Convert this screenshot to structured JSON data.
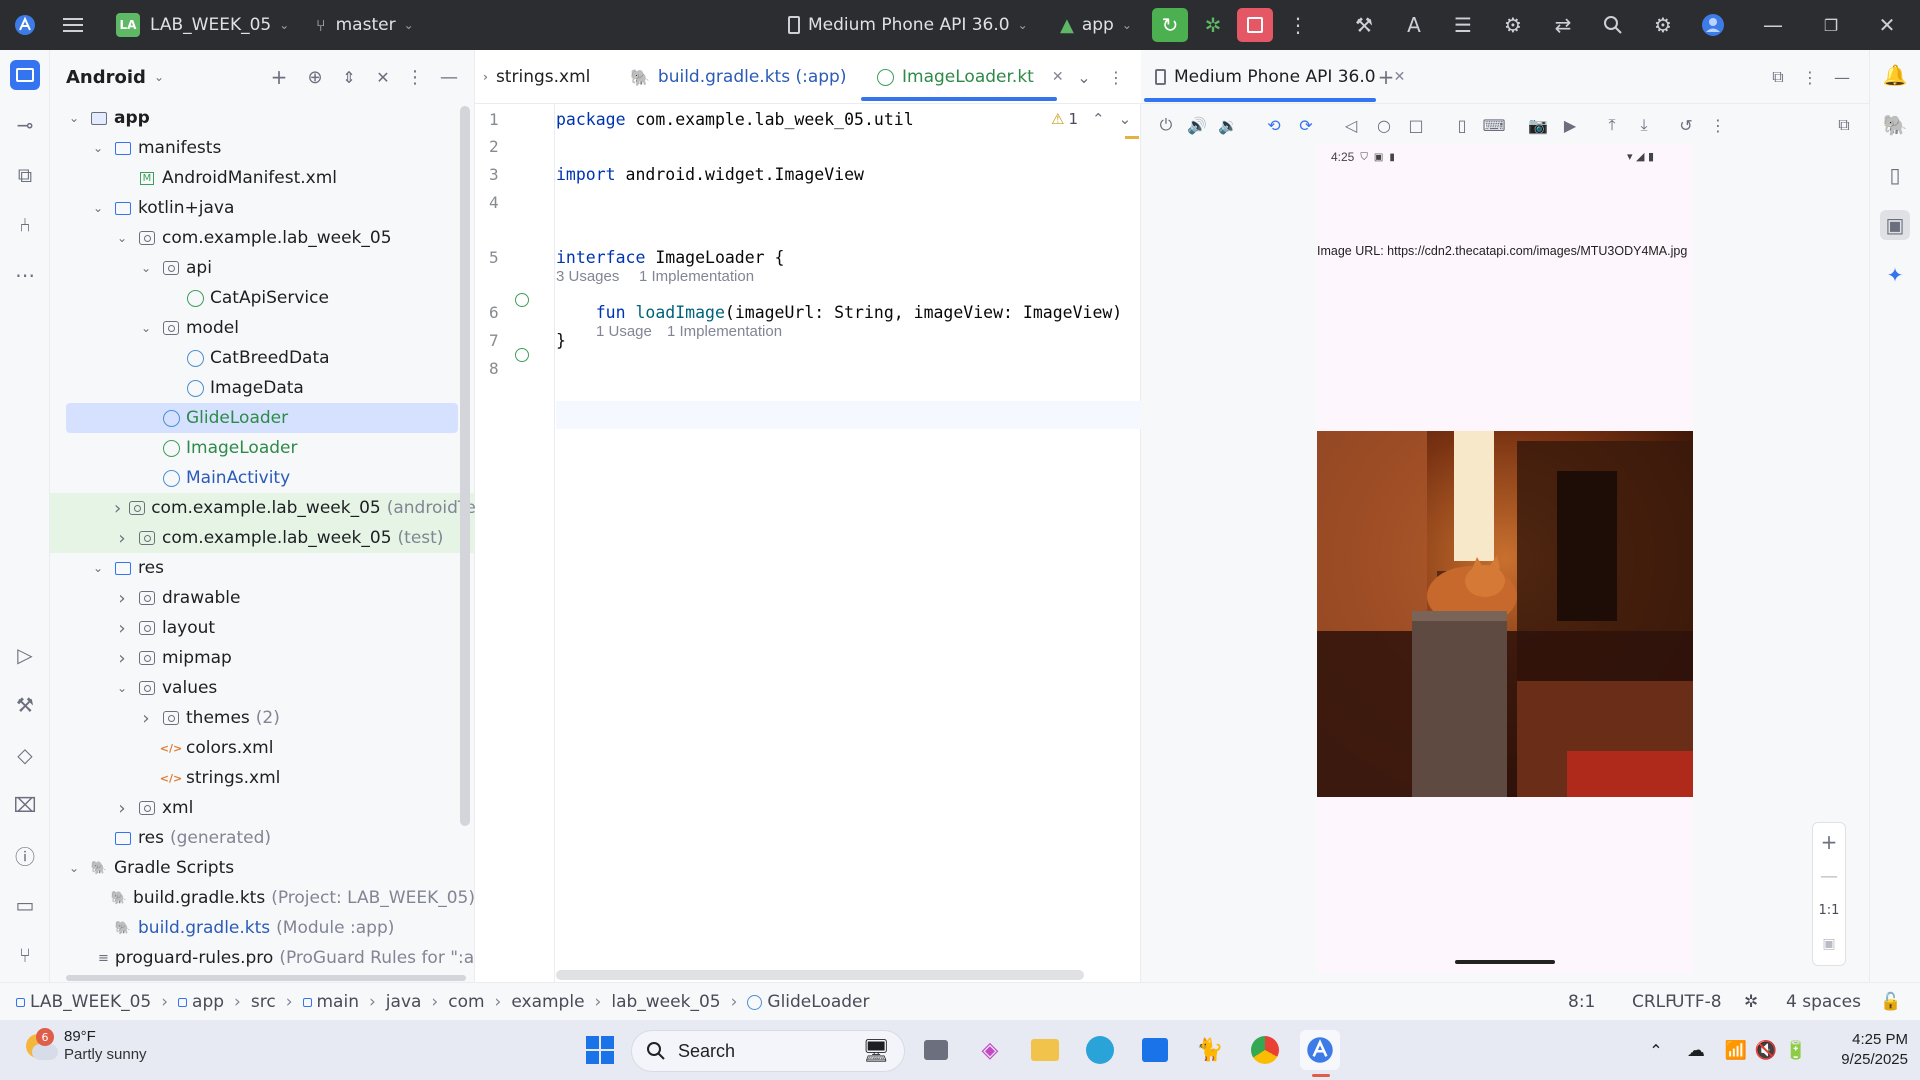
{
  "titlebar": {
    "project_badge": "LA",
    "project_name": "LAB_WEEK_05",
    "branch": "master",
    "device": "Medium Phone API 36.0",
    "run_config": "app",
    "window_controls": [
      "minimize-icon",
      "restore-icon",
      "close-icon"
    ]
  },
  "project_panel": {
    "view": "Android",
    "tree": [
      {
        "label": "app",
        "depth": 0,
        "icon": "module",
        "arrow": "open"
      },
      {
        "label": "manifests",
        "depth": 1,
        "icon": "folder",
        "arrow": "open"
      },
      {
        "label": "AndroidManifest.xml",
        "depth": 2,
        "icon": "manifest",
        "arrow": "none"
      },
      {
        "label": "kotlin+java",
        "depth": 1,
        "icon": "folder",
        "arrow": "open"
      },
      {
        "label": "com.example.lab_week_05",
        "depth": 2,
        "icon": "package",
        "arrow": "open"
      },
      {
        "label": "api",
        "depth": 3,
        "icon": "package",
        "arrow": "open"
      },
      {
        "label": "CatApiService",
        "depth": 4,
        "icon": "kotlin-interface",
        "arrow": "none"
      },
      {
        "label": "model",
        "depth": 3,
        "icon": "package",
        "arrow": "open"
      },
      {
        "label": "CatBreedData",
        "depth": 4,
        "icon": "kotlin-class",
        "arrow": "none"
      },
      {
        "label": "ImageData",
        "depth": 4,
        "icon": "kotlin-class",
        "arrow": "none"
      },
      {
        "label": "GlideLoader",
        "depth": 3,
        "icon": "kotlin-class",
        "arrow": "none",
        "selected": true
      },
      {
        "label": "ImageLoader",
        "depth": 3,
        "icon": "kotlin-interface",
        "arrow": "none"
      },
      {
        "label": "MainActivity",
        "depth": 3,
        "icon": "kotlin-class",
        "arrow": "none"
      },
      {
        "label": "com.example.lab_week_05",
        "suffix": "(androidTest)",
        "depth": 2,
        "icon": "package",
        "arrow": "closed",
        "highlight": true
      },
      {
        "label": "com.example.lab_week_05",
        "suffix": "(test)",
        "depth": 2,
        "icon": "package",
        "arrow": "closed",
        "highlight": true
      },
      {
        "label": "res",
        "depth": 1,
        "icon": "folder",
        "arrow": "open"
      },
      {
        "label": "drawable",
        "depth": 2,
        "icon": "package",
        "arrow": "closed"
      },
      {
        "label": "layout",
        "depth": 2,
        "icon": "package",
        "arrow": "closed"
      },
      {
        "label": "mipmap",
        "depth": 2,
        "icon": "package",
        "arrow": "closed"
      },
      {
        "label": "values",
        "depth": 2,
        "icon": "package",
        "arrow": "open"
      },
      {
        "label": "themes",
        "suffix": "(2)",
        "depth": 3,
        "icon": "package",
        "arrow": "closed"
      },
      {
        "label": "colors.xml",
        "depth": 3,
        "icon": "xml",
        "arrow": "none"
      },
      {
        "label": "strings.xml",
        "depth": 3,
        "icon": "xml",
        "arrow": "none"
      },
      {
        "label": "xml",
        "depth": 2,
        "icon": "package",
        "arrow": "closed"
      },
      {
        "label": "res",
        "suffix": "(generated)",
        "depth": 1,
        "icon": "folder",
        "arrow": "none"
      },
      {
        "label": "Gradle Scripts",
        "depth": 0,
        "icon": "gradle",
        "arrow": "open"
      },
      {
        "label": "build.gradle.kts",
        "suffix": "(Project: LAB_WEEK_05)",
        "depth": 1,
        "icon": "gradle",
        "arrow": "none"
      },
      {
        "label": "build.gradle.kts",
        "suffix": "(Module :app)",
        "depth": 1,
        "icon": "gradle",
        "arrow": "none",
        "blue": true
      },
      {
        "label": "proguard-rules.pro",
        "suffix": "(ProGuard Rules for \":ap",
        "depth": 1,
        "icon": "text",
        "arrow": "none"
      }
    ]
  },
  "editor": {
    "tabs": [
      {
        "label": "strings.xml",
        "icon": "xml",
        "active": false
      },
      {
        "label": "build.gradle.kts (:app)",
        "icon": "gradle",
        "active": false
      },
      {
        "label": "ImageLoader.kt",
        "icon": "kotlin-interface",
        "active": true
      }
    ],
    "warnings": "1",
    "line_numbers": [
      "1",
      "2",
      "3",
      "4",
      "5",
      "6",
      "7",
      "8"
    ],
    "lines": [
      {
        "kw": "package",
        "rest": " com.example.lab_week_05.util"
      },
      {
        "kw": "",
        "rest": ""
      },
      {
        "kw": "import",
        "rest": " android.widget.ImageView"
      },
      {
        "kw": "",
        "rest": ""
      },
      {
        "kw": "interface",
        "rest": " ImageLoader {"
      },
      {
        "kw": "    fun",
        "fn": " loadImage",
        "rest": "(imageUrl: String, imageView: ImageView)"
      },
      {
        "kw": "",
        "rest": "}"
      },
      {
        "kw": "",
        "rest": ""
      }
    ],
    "hint_interface_usages": "3 Usages",
    "hint_interface_impl": "1 Implementation",
    "hint_fun_usages": "1 Usage",
    "hint_fun_impl": "1 Implementation"
  },
  "emulator": {
    "tab_label": "Medium Phone API 36.0",
    "phone_time": "4:25",
    "image_url_text": "Image URL: https://cdn2.thecatapi.com/images/MTU3ODY4MA.jpg",
    "zoom_ratio": "1:1"
  },
  "statusbar": {
    "breadcrumbs": [
      "LAB_WEEK_05",
      "app",
      "src",
      "main",
      "java",
      "com",
      "example",
      "lab_week_05",
      "GlideLoader"
    ],
    "position": "8:1",
    "line_sep": "CRLF",
    "encoding": "UTF-8",
    "indent": "4 spaces"
  },
  "taskbar": {
    "weather_temp": "89°F",
    "weather_desc": "Partly sunny",
    "weather_badge": "6",
    "search_label": "Search",
    "time": "4:25 PM",
    "date": "9/25/2025"
  },
  "colors": {
    "accent": "#3574f0",
    "selection": "#d5e1ff",
    "highlight_row": "#e6f4e6",
    "run_green": "#4caf50",
    "stop_red": "#e55765"
  }
}
